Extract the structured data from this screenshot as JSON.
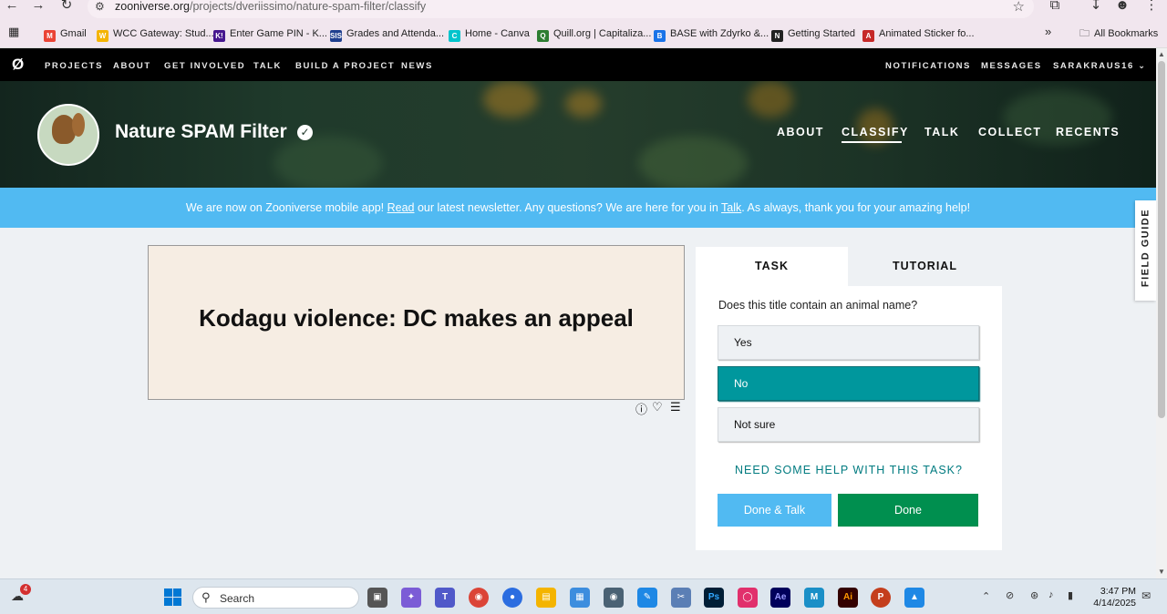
{
  "browser": {
    "url_host": "zooniverse.org",
    "url_path": "/projects/dveriissimo/nature-spam-filter/classify",
    "bookmarks": [
      {
        "label": "Gmail",
        "color": "#ea4335",
        "glyph": "M"
      },
      {
        "label": "WCC Gateway: Stud...",
        "color": "#f4b400",
        "glyph": "W"
      },
      {
        "label": "Enter Game PIN - K...",
        "color": "#46178f",
        "glyph": "K!"
      },
      {
        "label": "Grades and Attenda...",
        "color": "#1f3f8f",
        "glyph": "SIS"
      },
      {
        "label": "Home - Canva",
        "color": "#00c4cc",
        "glyph": "C"
      },
      {
        "label": "Quill.org | Capitaliza...",
        "color": "#2e7d32",
        "glyph": "Q"
      },
      {
        "label": "BASE with Zdyrko &...",
        "color": "#1a73e8",
        "glyph": "B"
      },
      {
        "label": "Getting Started",
        "color": "#222222",
        "glyph": "N"
      },
      {
        "label": "Animated Sticker fo...",
        "color": "#c62828",
        "glyph": "A"
      }
    ],
    "all_bookmarks": "All Bookmarks"
  },
  "zoo_nav": {
    "items": [
      "PROJECTS",
      "ABOUT",
      "GET INVOLVED",
      "TALK",
      "BUILD A PROJECT",
      "NEWS"
    ],
    "right": [
      "NOTIFICATIONS",
      "MESSAGES",
      "SARAKRAUS16"
    ]
  },
  "project": {
    "title": "Nature SPAM Filter",
    "nav": [
      "ABOUT",
      "CLASSIFY",
      "TALK",
      "COLLECT",
      "RECENTS"
    ],
    "active_nav": "CLASSIFY"
  },
  "announcement": {
    "part1": "We are now on Zooniverse mobile app! ",
    "link1": "Read",
    "part2": " our latest newsletter. Any questions? We are here for you in ",
    "link2": "Talk",
    "part3": ". As always, thank you for your amazing help!"
  },
  "subject": {
    "text": "Kodagu violence: DC makes an appeal",
    "icons": [
      "info-icon",
      "heart-icon",
      "list-icon"
    ]
  },
  "task_panel": {
    "tabs": [
      "TASK",
      "TUTORIAL"
    ],
    "active_tab": "TASK",
    "question": "Does this title contain an animal name?",
    "answers": [
      "Yes",
      "No",
      "Not sure"
    ],
    "selected_answer": "No",
    "help_link": "NEED SOME HELP WITH THIS TASK?",
    "done_talk": "Done & Talk",
    "done": "Done"
  },
  "field_guide": "FIELD GUIDE",
  "taskbar": {
    "search_placeholder": "Search",
    "notification_count": "4",
    "time": "3:47 PM",
    "date": "4/14/2025"
  },
  "colors": {
    "accent_teal": "#00979d",
    "done_green": "#008f4f",
    "announce_blue": "#51baf2"
  }
}
